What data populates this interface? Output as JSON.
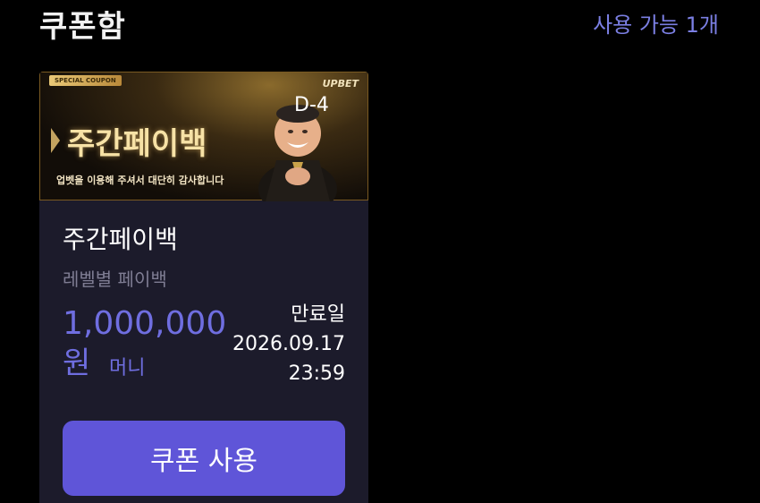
{
  "header": {
    "title": "쿠폰함",
    "available": "사용 가능 1개"
  },
  "coupon": {
    "banner": {
      "tag": "SPECIAL COUPON",
      "brand": "UPBET",
      "title": "주간페이백",
      "subtitle": "업벳을 이용해 주셔서 대단히 감사합니다",
      "dday": "D-4"
    },
    "name": "주간페이백",
    "description": "레벨별 페이백",
    "amount": "1,000,000",
    "amount_unit": "원",
    "amount_type": "머니",
    "expiry_label": "만료일",
    "expiry_date": "2026.09.17",
    "expiry_time": "23:59",
    "button_label": "쿠폰 사용"
  },
  "colors": {
    "accent": "#5f55d8",
    "amount": "#6f6ee0",
    "card_bg": "#1c1b2b"
  }
}
